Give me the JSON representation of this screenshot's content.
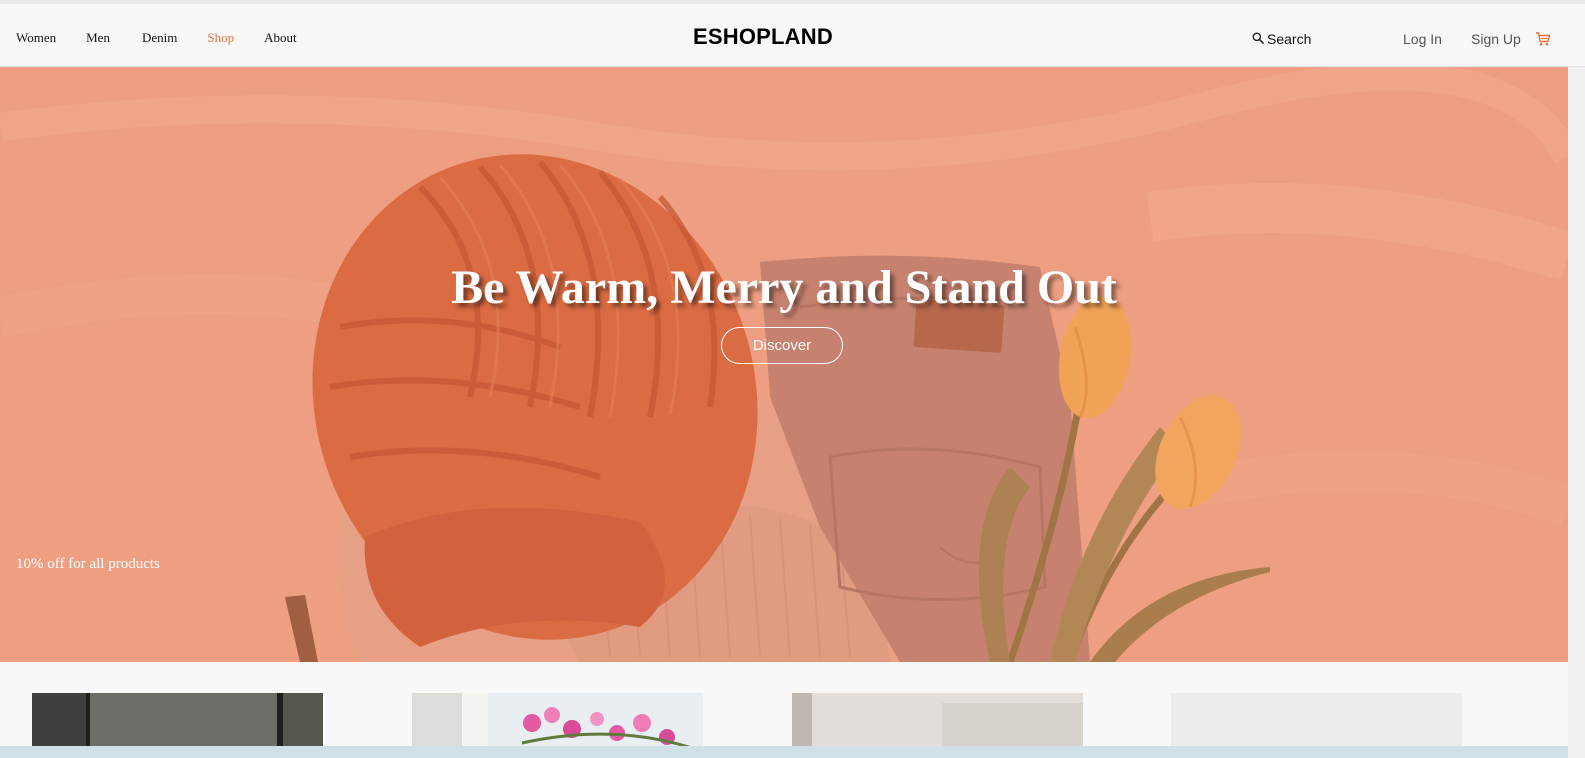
{
  "nav": {
    "items": [
      {
        "label": "Women",
        "active": false
      },
      {
        "label": "Men",
        "active": false
      },
      {
        "label": "Denim",
        "active": false
      },
      {
        "label": "Shop",
        "active": true
      },
      {
        "label": "About",
        "active": false
      }
    ]
  },
  "header": {
    "brand": "ESHOPLAND",
    "search_label": "Search",
    "login_label": "Log In",
    "signup_label": "Sign Up",
    "icons": {
      "search": "search-icon",
      "cart": "cart-icon"
    }
  },
  "hero": {
    "title": "Be Warm, Merry and Stand Out",
    "button_label": "Discover",
    "promo_text": "10% off for all products"
  },
  "colors": {
    "accent": "#e8703c",
    "hero_overlay": "#eb9c80",
    "text": "#111111"
  }
}
